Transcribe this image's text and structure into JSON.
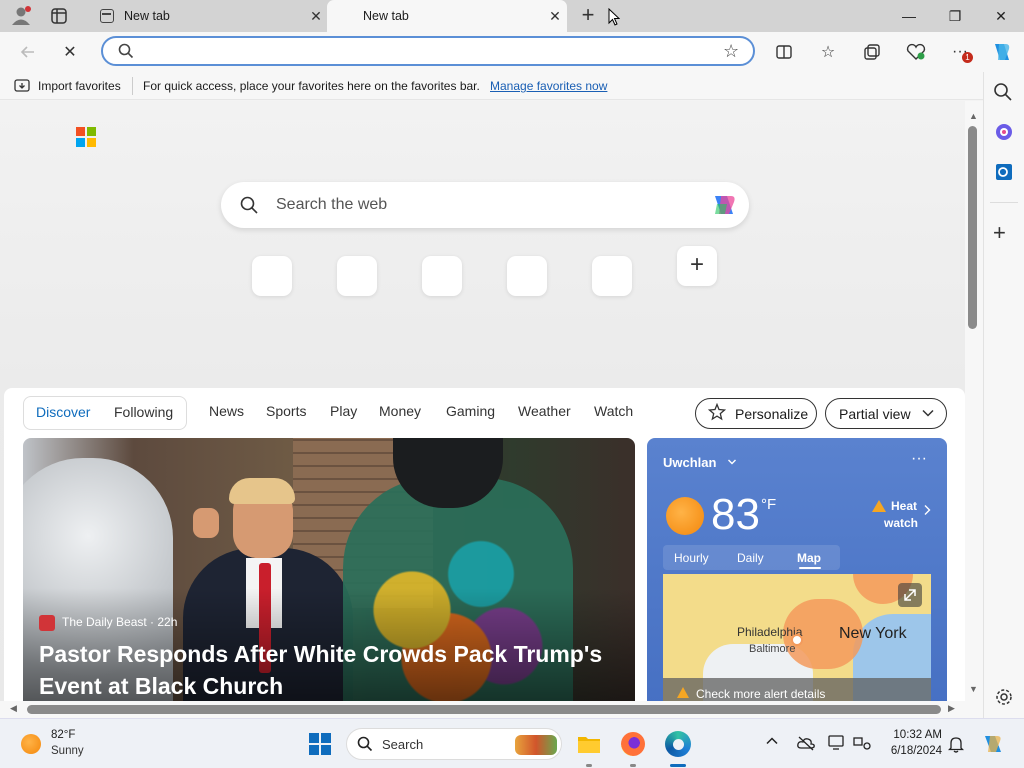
{
  "tabs": [
    {
      "title": "New tab"
    },
    {
      "title": "New tab"
    }
  ],
  "address_bar": {
    "value": ""
  },
  "favorites_bar": {
    "import_label": "Import favorites",
    "message": "For quick access, place your favorites here on the favorites bar.",
    "manage_link": "Manage favorites now"
  },
  "newtab": {
    "search_placeholder": "Search the web",
    "add_shortcut_glyph": "+"
  },
  "feed": {
    "tabs": [
      "Discover",
      "Following"
    ],
    "categories": [
      "News",
      "Sports",
      "Play",
      "Money",
      "Gaming",
      "Weather",
      "Watch"
    ],
    "personalize_label": "Personalize",
    "view_label": "Partial view"
  },
  "hero_story": {
    "source": "The Daily Beast · 22h",
    "headline_line1": "Pastor Responds After White Crowds Pack Trump's",
    "headline_line2": "Event at Black Church"
  },
  "weather": {
    "location": "Uwchlan",
    "temperature": "83",
    "unit": "°F",
    "alert_line1": "Heat",
    "alert_line2": "watch",
    "tabs": [
      "Hourly",
      "Daily",
      "Map"
    ],
    "map_labels": {
      "city1": "Philadelphia",
      "city2": "Baltimore",
      "city3": "New York"
    },
    "alert_bar": "Check more alert details"
  },
  "taskbar": {
    "temp": "82°F",
    "condition": "Sunny",
    "search_label": "Search",
    "time": "10:32 AM",
    "date": "6/18/2024"
  },
  "colors": {
    "accent": "#0f6cbd",
    "link": "#1a5fb4",
    "weather_bg": "#4f78c9",
    "sun": "#f7941d"
  }
}
